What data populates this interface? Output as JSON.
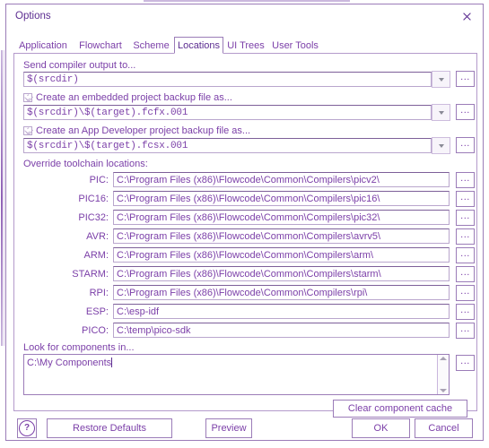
{
  "window": {
    "title": "Options",
    "close_icon": "close-icon"
  },
  "tabs": [
    {
      "label": "Application",
      "selected": false
    },
    {
      "label": "Flowchart",
      "selected": false
    },
    {
      "label": "Scheme",
      "selected": false
    },
    {
      "label": "Locations",
      "selected": true
    },
    {
      "label": "UI Trees",
      "selected": false
    },
    {
      "label": "User Tools",
      "selected": false
    }
  ],
  "compiler_output": {
    "label": "Send compiler output to...",
    "value": "$(srcdir)",
    "dropdown_icon": "chevron-down-icon",
    "browse_label": "..."
  },
  "embedded_backup": {
    "checkbox_label": "Create an embedded project backup file as...",
    "checked": true,
    "value": "$(srcdir)\\$(target).fcfx.001",
    "dropdown_icon": "chevron-down-icon",
    "browse_label": "..."
  },
  "appdev_backup": {
    "checkbox_label": "Create an App Developer project backup file as...",
    "checked": true,
    "value": "$(srcdir)\\$(target).fcsx.001",
    "dropdown_icon": "chevron-down-icon",
    "browse_label": "..."
  },
  "toolchains": {
    "heading": "Override toolchain locations:",
    "browse_label": "...",
    "rows": [
      {
        "label": "PIC:",
        "value": "C:\\Program Files (x86)\\Flowcode\\Common\\Compilers\\picv2\\"
      },
      {
        "label": "PIC16:",
        "value": "C:\\Program Files (x86)\\Flowcode\\Common\\Compilers\\pic16\\"
      },
      {
        "label": "PIC32:",
        "value": "C:\\Program Files (x86)\\Flowcode\\Common\\Compilers\\pic32\\"
      },
      {
        "label": "AVR:",
        "value": "C:\\Program Files (x86)\\Flowcode\\Common\\Compilers\\avrv5\\"
      },
      {
        "label": "ARM:",
        "value": "C:\\Program Files (x86)\\Flowcode\\Common\\Compilers\\arm\\"
      },
      {
        "label": "STARM:",
        "value": "C:\\Program Files (x86)\\Flowcode\\Common\\Compilers\\starm\\"
      },
      {
        "label": "RPI:",
        "value": "C:\\Program Files (x86)\\Flowcode\\Common\\Compilers\\rpi\\"
      },
      {
        "label": "ESP:",
        "value": "C:\\esp-idf"
      },
      {
        "label": "PICO:",
        "value": "C:\\temp\\pico-sdk"
      }
    ]
  },
  "components": {
    "label": "Look for components in...",
    "value": "C:\\My Components",
    "browse_label": "...",
    "scroll_up_icon": "triangle-up-icon",
    "scroll_down_icon": "triangle-down-icon",
    "clear_cache_label": "Clear component cache"
  },
  "footer": {
    "help_label": "?",
    "restore_defaults_label": "Restore Defaults",
    "preview_label": "Preview",
    "ok_label": "OK",
    "cancel_label": "Cancel"
  },
  "colors": {
    "text": "#7b3fa8",
    "border": "#9b7cb8",
    "background": "#ffffff"
  }
}
